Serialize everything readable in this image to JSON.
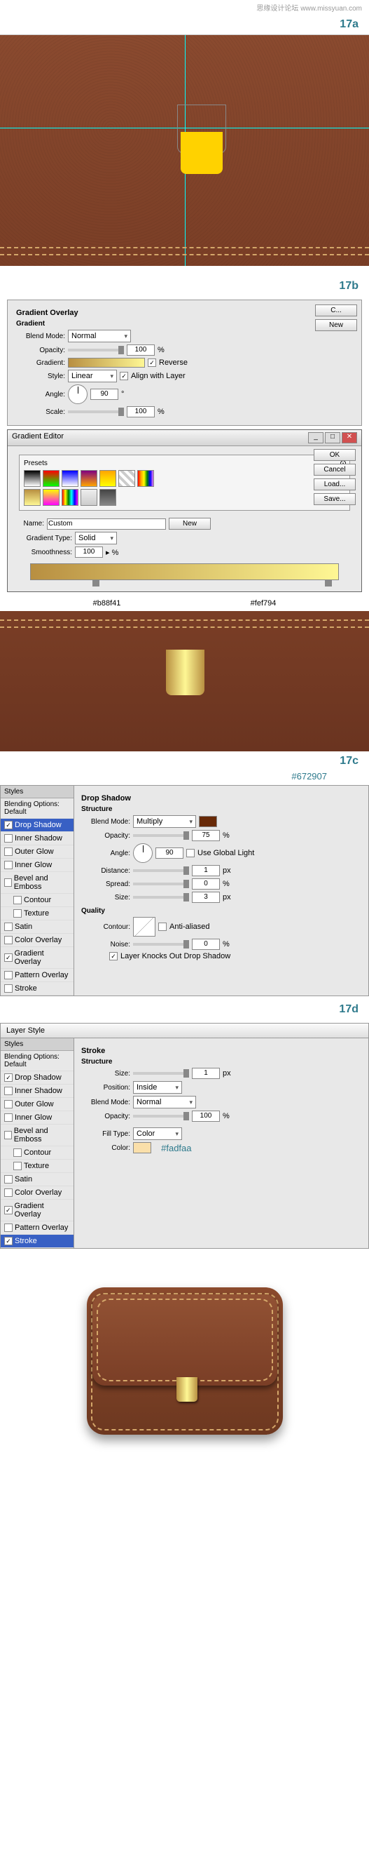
{
  "watermark": "思缘设计论坛 www.missyuan.com",
  "steps": {
    "a": "17a",
    "b": "17b",
    "c": "17c",
    "d": "17d"
  },
  "grad_overlay": {
    "title": "Gradient Overlay",
    "sub": "Gradient",
    "blend_lbl": "Blend Mode:",
    "blend": "Normal",
    "opacity_lbl": "Opacity:",
    "opacity": "100",
    "pct": "%",
    "grad_lbl": "Gradient:",
    "reverse": "Reverse",
    "style_lbl": "Style:",
    "style": "Linear",
    "align": "Align with Layer",
    "angle_lbl": "Angle:",
    "angle": "90",
    "deg": "°",
    "scale_lbl": "Scale:",
    "scale": "100"
  },
  "side_btns": {
    "c": "C...",
    "new": "New"
  },
  "ge": {
    "title": "Gradient Editor",
    "presets": "Presets",
    "ok": "OK",
    "cancel": "Cancel",
    "load": "Load...",
    "save": "Save...",
    "name_lbl": "Name:",
    "name": "Custom",
    "new": "New",
    "type_lbl": "Gradient Type:",
    "type": "Solid",
    "smooth_lbl": "Smoothness:",
    "smooth": "100"
  },
  "hex": {
    "left": "#b88f41",
    "right": "#fef794"
  },
  "ds": {
    "ann": "#672907",
    "hdr": "Drop Shadow",
    "struct": "Structure",
    "blend_lbl": "Blend Mode:",
    "blend": "Multiply",
    "opacity_lbl": "Opacity:",
    "opacity": "75",
    "angle_lbl": "Angle:",
    "angle": "90",
    "global": "Use Global Light",
    "dist_lbl": "Distance:",
    "dist": "1",
    "px": "px",
    "spread_lbl": "Spread:",
    "spread": "0",
    "size_lbl": "Size:",
    "size": "3",
    "quality": "Quality",
    "contour_lbl": "Contour:",
    "aa": "Anti-aliased",
    "noise_lbl": "Noise:",
    "noise": "0",
    "knock": "Layer Knocks Out Drop Shadow"
  },
  "styles": {
    "hdr": "Styles",
    "default": "Blending Options: Default",
    "items": [
      "Drop Shadow",
      "Inner Shadow",
      "Outer Glow",
      "Inner Glow",
      "Bevel and Emboss",
      "Contour",
      "Texture",
      "Satin",
      "Color Overlay",
      "Gradient Overlay",
      "Pattern Overlay",
      "Stroke"
    ]
  },
  "ls_title": "Layer Style",
  "stroke": {
    "hdr": "Stroke",
    "struct": "Structure",
    "size_lbl": "Size:",
    "size": "1",
    "px": "px",
    "pos_lbl": "Position:",
    "pos": "Inside",
    "blend_lbl": "Blend Mode:",
    "blend": "Normal",
    "opacity_lbl": "Opacity:",
    "opacity": "100",
    "fill_lbl": "Fill Type:",
    "fill": "Color",
    "color_lbl": "Color:",
    "ann": "#fadfaa"
  },
  "checked": {
    "ds": true,
    "go": true,
    "stroke": true
  }
}
